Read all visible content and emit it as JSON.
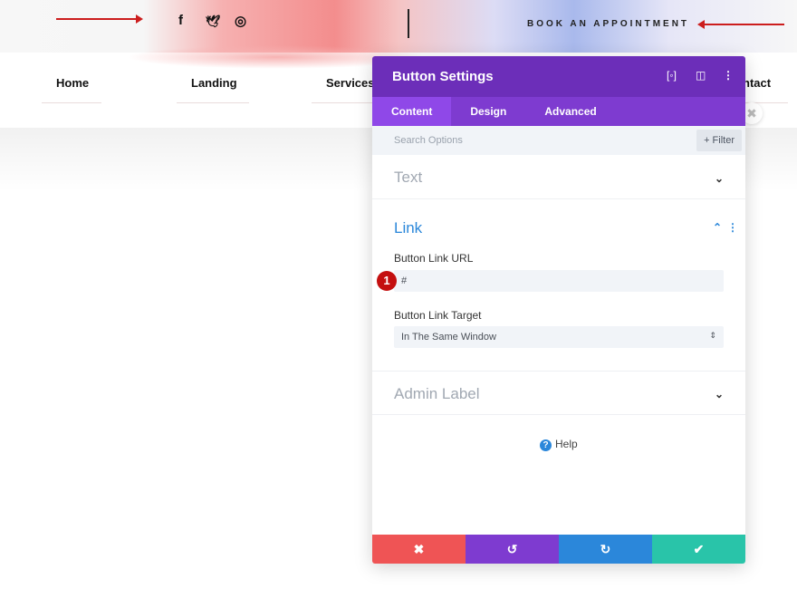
{
  "topbar": {
    "social": [
      {
        "icon": "facebook-icon",
        "glyph": "f"
      },
      {
        "icon": "twitter-icon",
        "glyph": "🐦"
      },
      {
        "icon": "instagram-icon",
        "glyph": "◎"
      }
    ],
    "cta": "BOOK AN APPOINTMENT"
  },
  "nav": {
    "items": [
      "Home",
      "Landing",
      "Services",
      "ntact"
    ]
  },
  "panel": {
    "title": "Button Settings",
    "tabs": [
      "Content",
      "Design",
      "Advanced"
    ],
    "search_placeholder": "Search Options",
    "filter_label": "+ Filter",
    "sections": {
      "text": "Text",
      "link": "Link",
      "admin": "Admin Label"
    },
    "link": {
      "url_label": "Button Link URL",
      "url_value": "#",
      "target_label": "Button Link Target",
      "target_value": "In The Same Window"
    },
    "annotation": "1",
    "help": "Help",
    "colors": {
      "header": "#6c2eb9",
      "tabs": "#7e3bd0",
      "cancel": "#ef5455",
      "undo": "#7e3bd0",
      "redo": "#2b87da",
      "save": "#29c4a9"
    }
  }
}
